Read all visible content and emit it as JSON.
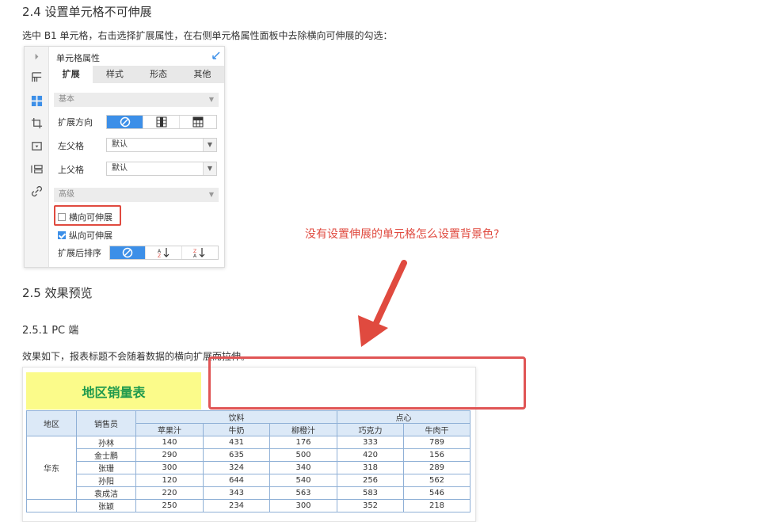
{
  "doc": {
    "h_24": "2.4 设置单元格不可伸展",
    "p_24": "选中 B1 单元格，右击选择扩展属性，在右侧单元格属性面板中去除横向可伸展的勾选：",
    "h_25": "2.5 效果预览",
    "h_251": "2.5.1 PC 端",
    "p_251": "效果如下，报表标题不会随着数据的横向扩展而拉伸。",
    "annotation": "没有设置伸展的单元格怎么设置背景色?"
  },
  "panel": {
    "title": "单元格属性",
    "tabs": [
      "扩展",
      "样式",
      "形态",
      "其他"
    ],
    "section_basic": "基本",
    "expand_dir_label": "扩展方向",
    "left_parent_label": "左父格",
    "left_parent_value": "默认",
    "top_parent_label": "上父格",
    "top_parent_value": "默认",
    "section_advanced": "高级",
    "h_stretch_label": "横向可伸展",
    "h_stretch_checked": false,
    "v_stretch_label": "纵向可伸展",
    "v_stretch_checked": true,
    "sort_label": "扩展后排序",
    "sort_opt2": "升",
    "sort_opt3": "降"
  },
  "report": {
    "title": "地区销量表",
    "col_region": "地区",
    "col_sales": "销售员",
    "group_drinks": "饮料",
    "group_snacks": "点心",
    "products": [
      "苹果汁",
      "牛奶",
      "柳橙汁",
      "巧克力",
      "牛肉干"
    ],
    "region1": "华东",
    "rows": [
      {
        "name": "孙林",
        "values": [
          "140",
          "431",
          "176",
          "333",
          "789"
        ]
      },
      {
        "name": "金士鹏",
        "values": [
          "290",
          "635",
          "500",
          "420",
          "156"
        ]
      },
      {
        "name": "张珊",
        "values": [
          "300",
          "324",
          "340",
          "318",
          "289"
        ]
      },
      {
        "name": "孙阳",
        "values": [
          "120",
          "644",
          "540",
          "256",
          "562"
        ]
      },
      {
        "name": "袁成洁",
        "values": [
          "220",
          "343",
          "563",
          "583",
          "546"
        ]
      },
      {
        "name": "张颖",
        "values": [
          "250",
          "234",
          "300",
          "352",
          "218"
        ]
      }
    ]
  },
  "colors": {
    "accent_blue": "#3c8fe8",
    "annotation_red": "#e04a3f",
    "title_green": "#1f9a4d",
    "title_bg": "#fbfb8a",
    "header_bg": "#dce9f7"
  }
}
